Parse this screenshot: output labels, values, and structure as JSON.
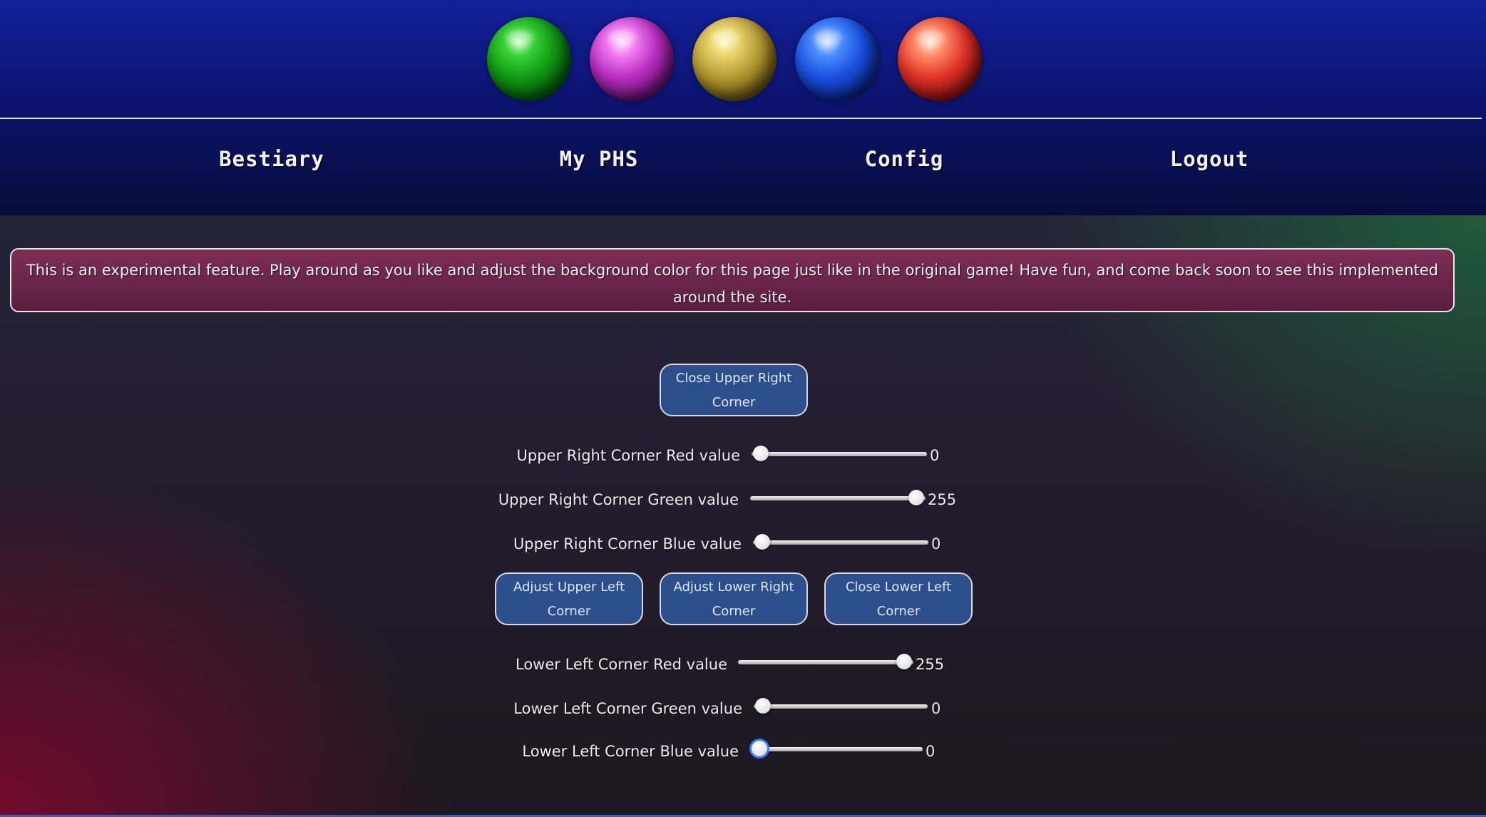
{
  "header": {
    "orbs": [
      {
        "color": "green",
        "icon": "green-orb-icon"
      },
      {
        "color": "pink",
        "icon": "pink-orb-icon"
      },
      {
        "color": "yellow",
        "icon": "yellow-orb-icon"
      },
      {
        "color": "blue",
        "icon": "blue-orb-icon"
      },
      {
        "color": "red",
        "icon": "red-orb-icon"
      }
    ]
  },
  "nav": {
    "items": [
      {
        "label": "Bestiary"
      },
      {
        "label": "My PHS"
      },
      {
        "label": "Config"
      },
      {
        "label": "Logout"
      }
    ]
  },
  "notice": {
    "text": "This is an experimental feature. Play around as you like and adjust the background color for this page just like in the original game! Have fun, and come back soon to see this implemented around the site."
  },
  "controls": {
    "close_upper_right": "Close Upper Right Corner",
    "adjust_upper_left": "Adjust Upper Left Corner",
    "adjust_lower_right": "Adjust Lower Right Corner",
    "close_lower_left": "Close Lower Left Corner"
  },
  "sliders": {
    "max": 255,
    "upper_right": [
      {
        "label": "Upper Right Corner Red value",
        "value": 0,
        "display": "0"
      },
      {
        "label": "Upper Right Corner Green value",
        "value": 255,
        "display": "255"
      },
      {
        "label": "Upper Right Corner Blue value",
        "value": 0,
        "display": "0"
      }
    ],
    "lower_left": [
      {
        "label": "Lower Left Corner Red value",
        "value": 255,
        "display": "255"
      },
      {
        "label": "Lower Left Corner Green value",
        "value": 0,
        "display": "0"
      },
      {
        "label": "Lower Left Corner Blue value",
        "value": 0,
        "display": "0"
      }
    ]
  },
  "colors": {
    "header_top": "#13209a",
    "notice_bg": "#6e2850",
    "button_bg": "#2c4f8c",
    "upper_right_corner": "#00ff00",
    "lower_left_corner": "#ff0000"
  }
}
